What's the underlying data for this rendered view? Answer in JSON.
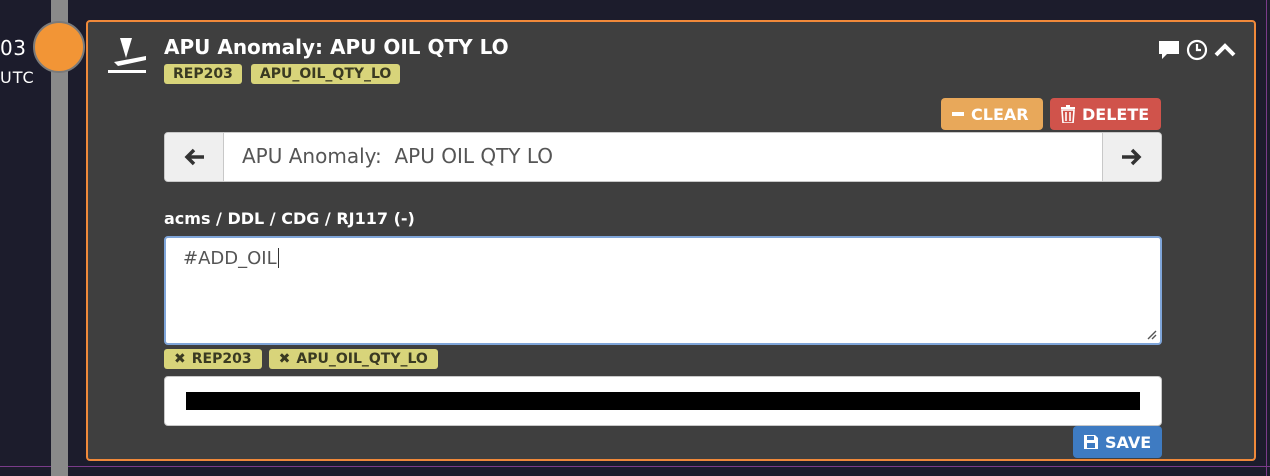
{
  "timeline": {
    "time_partial": "03",
    "timezone": "UTC",
    "dot_color": "#f29536"
  },
  "card": {
    "title": "APU Anomaly: APU OIL QTY LO",
    "icon": "plane-takeoff-icon",
    "border_color": "#f0893a",
    "tags": [
      "REP203",
      "APU_OIL_QTY_LO"
    ],
    "header_icons": [
      "comment-icon",
      "clock-icon",
      "chevron-up-icon"
    ]
  },
  "actions": {
    "clear_label": "CLEAR",
    "delete_label": "DELETE",
    "clear_color": "#e8a85a",
    "delete_color": "#d0534b"
  },
  "nav": {
    "input_value": "APU Anomaly:  APU OIL QTY LO",
    "prev_icon": "arrow-left-icon",
    "next_icon": "arrow-right-icon"
  },
  "note": {
    "path": "acms / DDL / CDG / RJ117 (-)",
    "value": "#ADD_OIL"
  },
  "note_tags": [
    "REP203",
    "APU_OIL_QTY_LO"
  ],
  "save": {
    "label": "SAVE",
    "color": "#3e7bc2"
  }
}
